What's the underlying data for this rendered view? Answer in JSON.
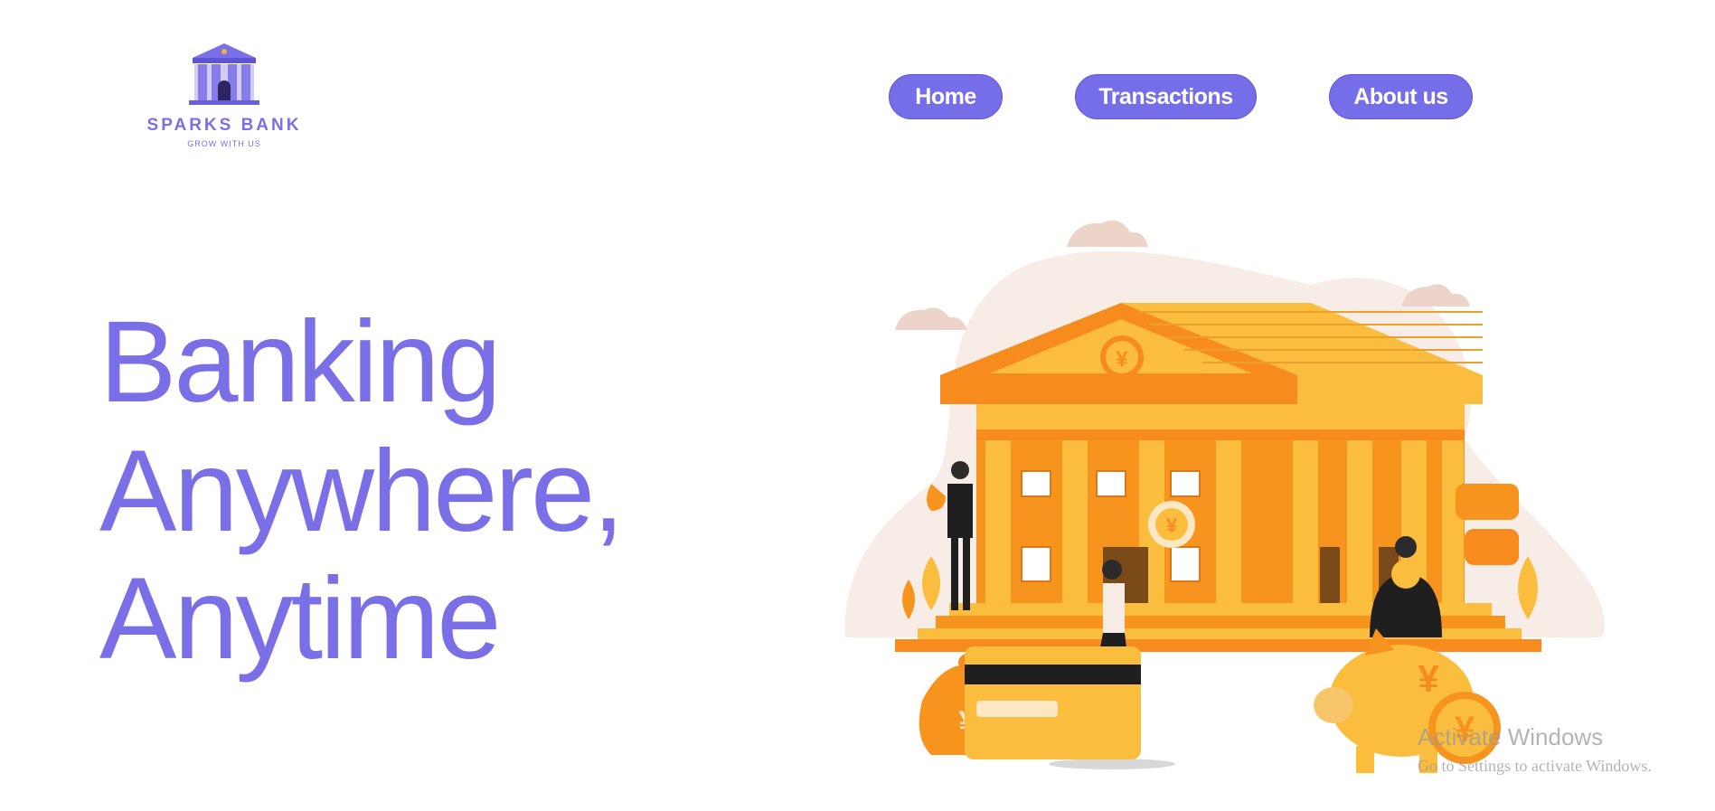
{
  "brand": {
    "name": "SPARKS BANK",
    "tagline": "GROW WITH US",
    "accent_color": "#766ee8",
    "logo_icon": "bank-building-icon"
  },
  "nav": {
    "home_label": "Home",
    "transactions_label": "Transactions",
    "about_label": "About us"
  },
  "hero": {
    "line1": "Banking",
    "line2": "Anywhere,",
    "line3": "Anytime"
  },
  "illustration": {
    "subject": "bank-building-illustration",
    "currency_symbol": "¥"
  },
  "watermark": {
    "title": "Activate Windows",
    "subtitle": "Go to Settings to activate Windows."
  }
}
